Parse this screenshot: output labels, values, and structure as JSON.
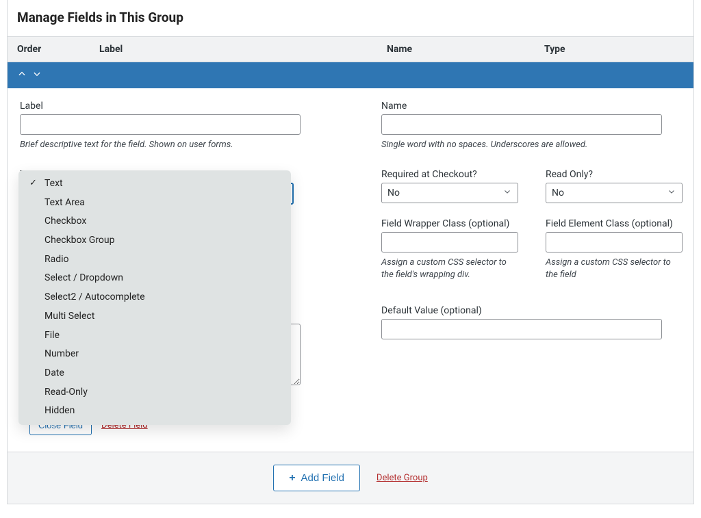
{
  "panel": {
    "title": "Manage Fields in This Group"
  },
  "grid_header": {
    "order": "Order",
    "label": "Label",
    "name": "Name",
    "type": "Type"
  },
  "form": {
    "label_label": "Label",
    "label_hint": "Brief descriptive text for the field. Shown on user forms.",
    "name_label": "Name",
    "name_hint": "Single word with no spaces. Underscores are allowed.",
    "type_label": "Type",
    "required_label": "Required at Checkout?",
    "required_value": "No",
    "readonly_label": "Read Only?",
    "readonly_value": "No",
    "wrapper_class_label": "Field Wrapper Class (optional)",
    "wrapper_class_hint": "Assign a custom CSS selector to the field's wrapping div.",
    "element_class_label": "Field Element Class (optional)",
    "element_class_hint": "Assign a custom CSS selector to the field",
    "default_value_label": "Default Value (optional)"
  },
  "type_options": [
    "Text",
    "Text Area",
    "Checkbox",
    "Checkbox Group",
    "Radio",
    "Select / Dropdown",
    "Select2 / Autocomplete",
    "Multi Select",
    "File",
    "Number",
    "Date",
    "Read-Only",
    "Hidden"
  ],
  "type_selected_index": 0,
  "actions": {
    "close_field": "Close Field",
    "delete_field": "Delete Field",
    "add_field": "Add Field",
    "delete_group": "Delete Group"
  }
}
